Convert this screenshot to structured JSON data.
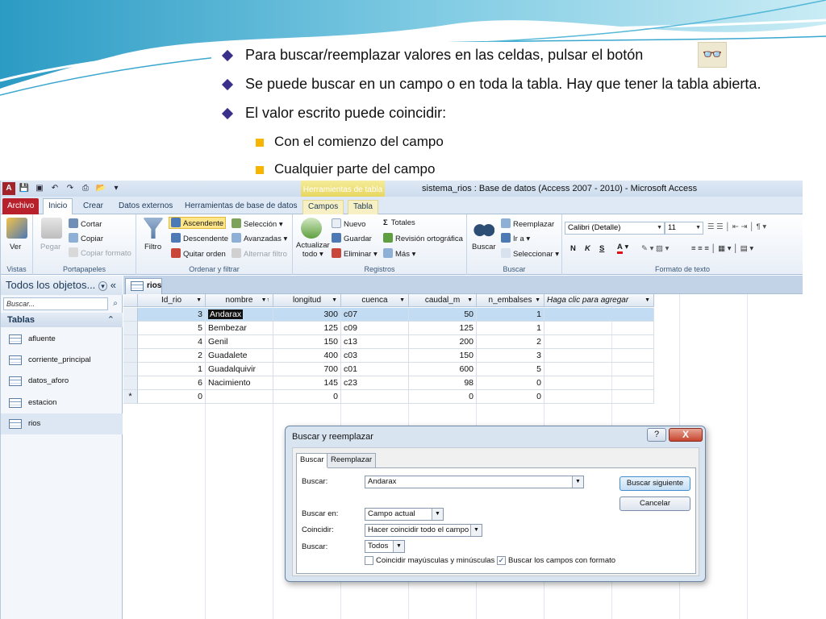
{
  "slide": {
    "bullets": [
      "Para buscar/reemplazar valores en las celdas, pulsar el botón",
      "Se puede buscar en un campo o en toda la tabla. Hay que tener la tabla abierta.",
      "El valor escrito puede coincidir:"
    ],
    "subbullets": [
      "Con el comienzo del campo",
      "Cualquier parte del campo"
    ],
    "binoculars_icon": "binoculars-icon"
  },
  "app": {
    "title": "sistema_rios : Base de datos (Access 2007 - 2010)  -  Microsoft Access",
    "context_tab_group": "Herramientas de tabla",
    "tabs": [
      "Archivo",
      "Inicio",
      "Crear",
      "Datos externos",
      "Herramientas de base de datos",
      "Campos",
      "Tabla"
    ],
    "colors": {
      "archivo_tab": "#b8202b",
      "context_tab": "#e7d65e",
      "selection": "#c2dcf3"
    }
  },
  "ribbon": {
    "vistas": {
      "label": "Vistas",
      "ver": "Ver"
    },
    "portapapeles": {
      "label": "Portapapeles",
      "pegar": "Pegar",
      "cortar": "Cortar",
      "copiar": "Copiar",
      "copiar_formato": "Copiar formato"
    },
    "ordenar": {
      "label": "Ordenar y filtrar",
      "filtro": "Filtro",
      "ascendente": "Ascendente",
      "descendente": "Descendente",
      "quitar_orden": "Quitar orden",
      "seleccion": "Selección",
      "avanzadas": "Avanzadas",
      "alternar_filtro": "Alternar filtro"
    },
    "registros": {
      "label": "Registros",
      "actualizar": "Actualizar",
      "todo": "todo",
      "nuevo": "Nuevo",
      "guardar": "Guardar",
      "eliminar": "Eliminar",
      "totales": "Totales",
      "revision": "Revisión ortográfica",
      "mas": "Más"
    },
    "buscar": {
      "label": "Buscar",
      "buscar": "Buscar",
      "reemplazar": "Reemplazar",
      "ir_a": "Ir a",
      "seleccionar": "Seleccionar"
    },
    "formato": {
      "label": "Formato de texto",
      "font": "Calibri (Detalle)",
      "size": "11",
      "bold": "N",
      "italic": "K",
      "underline": "S",
      "font_color": "A"
    }
  },
  "nav": {
    "header": "Todos los objetos...",
    "search_placeholder": "Buscar...",
    "group": "Tablas",
    "items": [
      "afluente",
      "corriente_principal",
      "datos_aforo",
      "estacion",
      "rios"
    ]
  },
  "datasheet": {
    "tab": "rios",
    "columns": [
      "Id_rio",
      "nombre",
      "longitud",
      "cuenca",
      "caudal_m",
      "n_embalses",
      "Haga clic para agregar"
    ],
    "rows": [
      [
        "3",
        "Andarax",
        "300",
        "c07",
        "50",
        "1"
      ],
      [
        "5",
        "Bembezar",
        "125",
        "c09",
        "125",
        "1"
      ],
      [
        "4",
        "Genil",
        "150",
        "c13",
        "200",
        "2"
      ],
      [
        "2",
        "Guadalete",
        "400",
        "c03",
        "150",
        "3"
      ],
      [
        "1",
        "Guadalquivir",
        "700",
        "c01",
        "600",
        "5"
      ],
      [
        "6",
        "Nacimiento",
        "145",
        "c23",
        "98",
        "0"
      ]
    ],
    "new_row": {
      "marker": "*",
      "id": "0",
      "longitud": "0",
      "caudal": "0",
      "embalses": "0"
    }
  },
  "dialog": {
    "title": "Buscar y reemplazar",
    "help": "?",
    "close": "X",
    "tabs": [
      "Buscar",
      "Reemplazar"
    ],
    "buscar_label": "Buscar:",
    "buscar_value": "Andarax",
    "buscar_en_label": "Buscar en:",
    "buscar_en_value": "Campo actual",
    "coincidir_label": "Coincidir:",
    "coincidir_value": "Hacer coincidir todo el campo",
    "direccion_label": "Buscar:",
    "direccion_value": "Todos",
    "match_case_label": "Coincidir mayúsculas y minúsculas",
    "match_case_checked": false,
    "format_label": "Buscar los campos con formato",
    "format_checked": true,
    "find_next": "Buscar siguiente",
    "cancel": "Cancelar"
  }
}
